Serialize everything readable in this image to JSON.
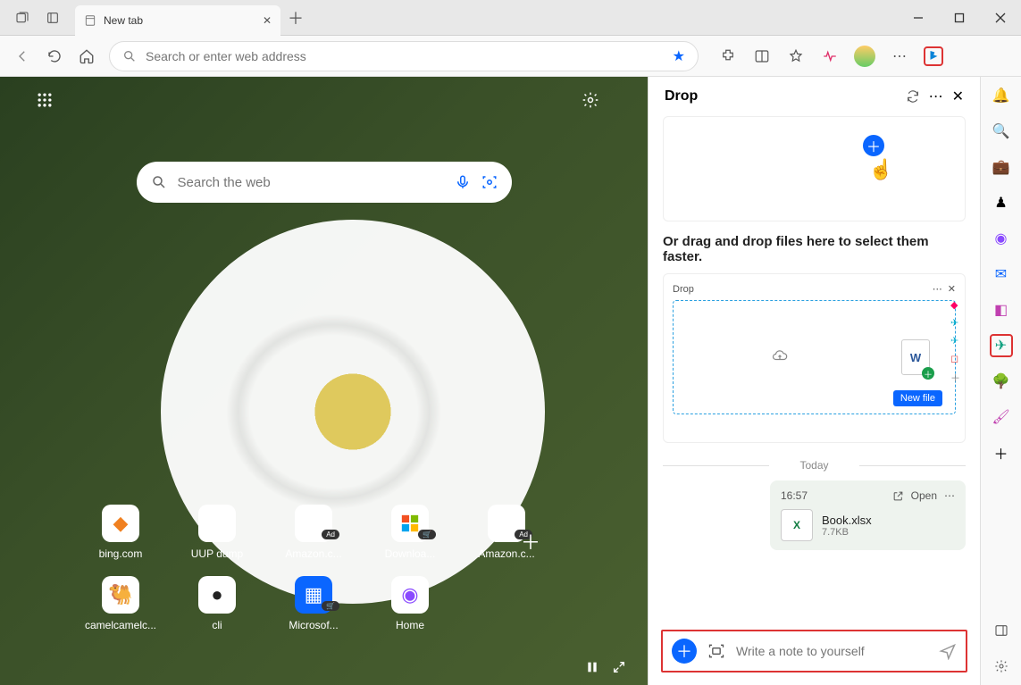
{
  "window": {
    "tab_title": "New tab"
  },
  "toolbar": {
    "address_placeholder": "Search or enter web address"
  },
  "newtab": {
    "search_placeholder": "Search the web",
    "links": [
      {
        "label": "bing.com",
        "icon": "◆",
        "icon_color": "#f08020",
        "badge": ""
      },
      {
        "label": "UUP dump",
        "icon": "🗄",
        "icon_color": "#888",
        "badge": ""
      },
      {
        "label": "Amazon.c...",
        "icon": "a",
        "icon_color": "#000",
        "badge": "Ad"
      },
      {
        "label": "Downloa...",
        "icon": "⊞",
        "icon_color": "#00a4ef",
        "badge": "🛒"
      },
      {
        "label": "Amazon.c...",
        "icon": "a",
        "icon_color": "#000",
        "badge": "Ad"
      },
      {
        "label": "",
        "icon": "",
        "icon_color": "",
        "badge": ""
      },
      {
        "label": "camelcamelc...",
        "icon": "🐫",
        "icon_color": "#c08050",
        "badge": ""
      },
      {
        "label": "cli",
        "icon": "●",
        "icon_color": "#222",
        "badge": ""
      },
      {
        "label": "Microsof...",
        "icon": "▦",
        "icon_color": "#0a66ff",
        "badge": "🛒"
      },
      {
        "label": "Home",
        "icon": "◉",
        "icon_color": "#8a4aff",
        "badge": ""
      }
    ]
  },
  "drop": {
    "title": "Drop",
    "drag_text": "Or drag and drop files here to select them faster.",
    "illus_label": "Drop",
    "newfile_badge": "New file",
    "today_label": "Today",
    "file": {
      "time": "16:57",
      "open": "Open",
      "name": "Book.xlsx",
      "size": "7.7KB"
    },
    "input_placeholder": "Write a note to yourself"
  }
}
